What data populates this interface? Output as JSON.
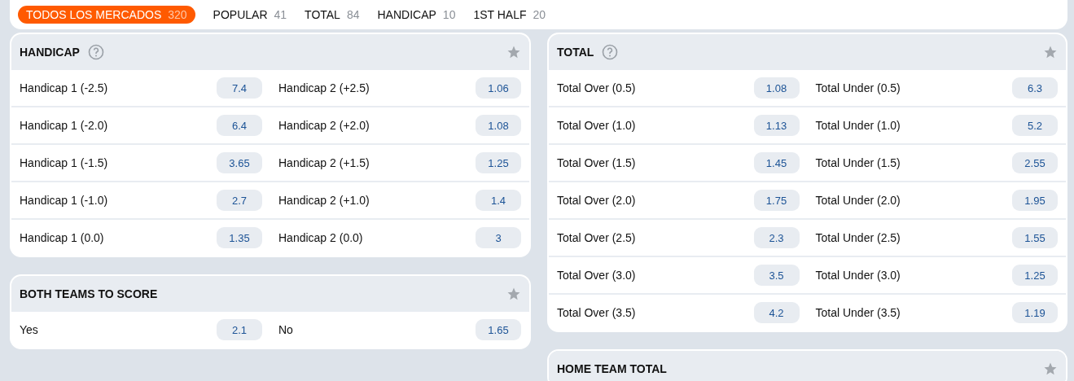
{
  "tabs": [
    {
      "label": "TODOS LOS MERCADOS",
      "count": "320",
      "selected": true
    },
    {
      "label": "POPULAR",
      "count": "41",
      "selected": false
    },
    {
      "label": "TOTAL",
      "count": "84",
      "selected": false
    },
    {
      "label": "HANDICAP",
      "count": "10",
      "selected": false
    },
    {
      "label": "1ST HALF",
      "count": "20",
      "selected": false
    }
  ],
  "columns": [
    {
      "markets": [
        {
          "title": "HANDICAP",
          "help": true,
          "rows": [
            [
              {
                "label": "Handicap 1 (-2.5)",
                "odds": "7.4"
              },
              {
                "label": "Handicap 2 (+2.5)",
                "odds": "1.06"
              }
            ],
            [
              {
                "label": "Handicap 1 (-2.0)",
                "odds": "6.4"
              },
              {
                "label": "Handicap 2 (+2.0)",
                "odds": "1.08"
              }
            ],
            [
              {
                "label": "Handicap 1 (-1.5)",
                "odds": "3.65"
              },
              {
                "label": "Handicap 2 (+1.5)",
                "odds": "1.25"
              }
            ],
            [
              {
                "label": "Handicap 1 (-1.0)",
                "odds": "2.7"
              },
              {
                "label": "Handicap 2 (+1.0)",
                "odds": "1.4"
              }
            ],
            [
              {
                "label": "Handicap 1 (0.0)",
                "odds": "1.35"
              },
              {
                "label": "Handicap 2 (0.0)",
                "odds": "3"
              }
            ]
          ]
        },
        {
          "title": "BOTH TEAMS TO SCORE",
          "rows": [
            [
              {
                "label": "Yes",
                "odds": "2.1"
              },
              {
                "label": "No",
                "odds": "1.65"
              }
            ]
          ]
        }
      ]
    },
    {
      "markets": [
        {
          "title": "TOTAL",
          "help": true,
          "rows": [
            [
              {
                "label": "Total Over (0.5)",
                "odds": "1.08"
              },
              {
                "label": "Total Under (0.5)",
                "odds": "6.3"
              }
            ],
            [
              {
                "label": "Total Over (1.0)",
                "odds": "1.13"
              },
              {
                "label": "Total Under (1.0)",
                "odds": "5.2"
              }
            ],
            [
              {
                "label": "Total Over (1.5)",
                "odds": "1.45"
              },
              {
                "label": "Total Under (1.5)",
                "odds": "2.55"
              }
            ],
            [
              {
                "label": "Total Over (2.0)",
                "odds": "1.75"
              },
              {
                "label": "Total Under (2.0)",
                "odds": "1.95"
              }
            ],
            [
              {
                "label": "Total Over (2.5)",
                "odds": "2.3"
              },
              {
                "label": "Total Under (2.5)",
                "odds": "1.55"
              }
            ],
            [
              {
                "label": "Total Over (3.0)",
                "odds": "3.5"
              },
              {
                "label": "Total Under (3.0)",
                "odds": "1.25"
              }
            ],
            [
              {
                "label": "Total Over (3.5)",
                "odds": "4.2"
              },
              {
                "label": "Total Under (3.5)",
                "odds": "1.19"
              }
            ]
          ]
        },
        {
          "title": "HOME TEAM TOTAL"
        }
      ]
    }
  ]
}
